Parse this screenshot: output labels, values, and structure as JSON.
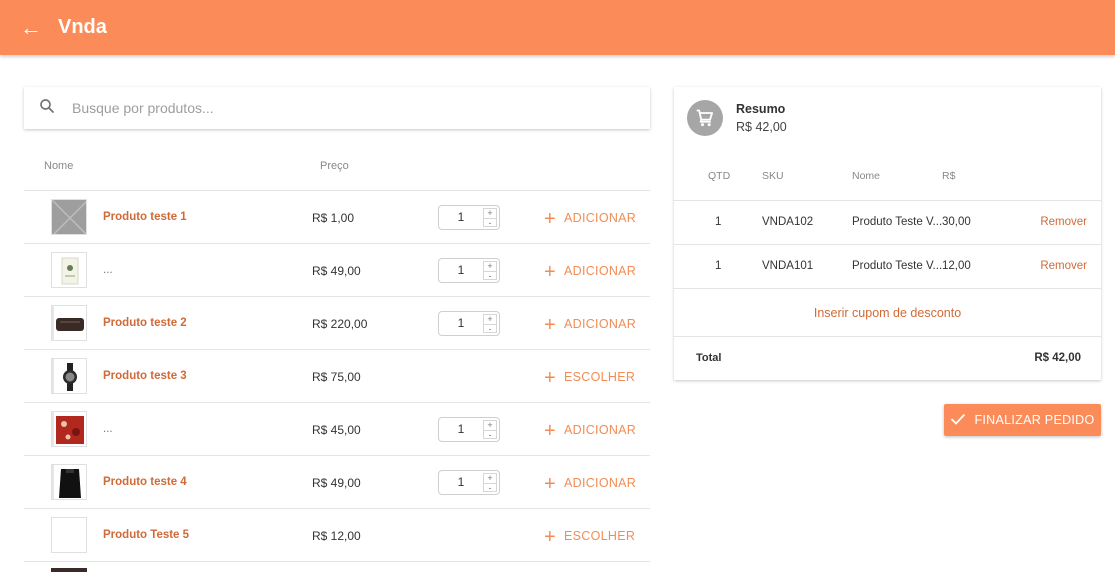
{
  "header": {
    "back_icon": "arrow-back-icon",
    "back_glyph": "←",
    "title": "Vnda",
    "color": "#fb8c5a"
  },
  "search": {
    "icon": "search-icon",
    "placeholder": "Busque por produtos...",
    "value": ""
  },
  "product_table": {
    "headers": {
      "name": "Nome",
      "price": "Preço"
    },
    "rows": [
      {
        "thumb": "placeholder-image",
        "name": "Produto teste 1",
        "price": "R$ 1,00",
        "qty": "1",
        "qty_up": "+",
        "qty_down": "-",
        "action": "ADICIONAR"
      },
      {
        "thumb": "product-box-image",
        "name": "...",
        "price": "R$ 49,00",
        "qty": "1",
        "qty_up": "+",
        "qty_down": "-",
        "action": "ADICIONAR"
      },
      {
        "thumb": "bag-image",
        "name": "Produto teste 2",
        "price": "R$ 220,00",
        "qty": "1",
        "qty_up": "+",
        "qty_down": "-",
        "action": "ADICIONAR"
      },
      {
        "thumb": "watch-image",
        "name": "Produto teste 3",
        "price": "R$ 75,00",
        "action": "ESCOLHER"
      },
      {
        "thumb": "red-print-image",
        "name": "...",
        "price": "R$ 45,00",
        "qty": "1",
        "qty_up": "+",
        "qty_down": "-",
        "action": "ADICIONAR"
      },
      {
        "thumb": "black-garment-image",
        "name": "Produto teste 4",
        "price": "R$ 49,00",
        "qty": "1",
        "qty_up": "+",
        "qty_down": "-",
        "action": "ADICIONAR"
      },
      {
        "thumb": "blank-image",
        "name": "Produto Teste 5",
        "price": "R$ 12,00",
        "action": "ESCOLHER"
      }
    ],
    "action_icon": "plus-icon",
    "accent": "#f28c55"
  },
  "summary": {
    "icon": "shopping-cart-icon",
    "title": "Resumo",
    "total_top": "R$ 42,00",
    "headers": {
      "qtd": "QTD",
      "sku": "SKU",
      "name": "Nome",
      "price": "R$"
    },
    "items": [
      {
        "qtd": "1",
        "sku": "VNDA102",
        "name": "Produto Teste V...",
        "price": "30,00",
        "remove": "Remover"
      },
      {
        "qtd": "1",
        "sku": "VNDA101",
        "name": "Produto Teste V...",
        "price": "12,00",
        "remove": "Remover"
      }
    ],
    "coupon_link": "Inserir cupom de desconto",
    "total_label": "Total",
    "total_value": "R$ 42,00"
  },
  "finalize": {
    "icon": "check-icon",
    "label": "FINALIZAR PEDIDO"
  }
}
